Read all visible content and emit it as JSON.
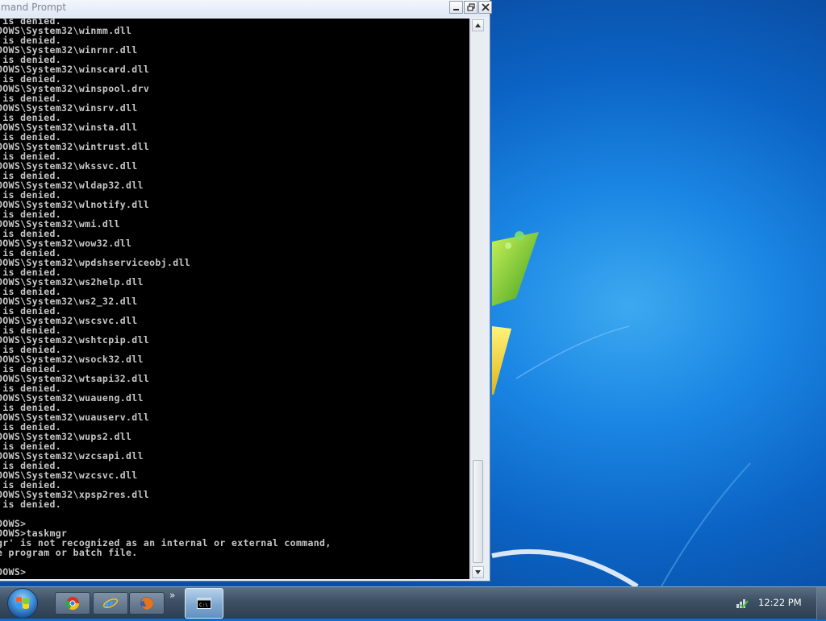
{
  "window": {
    "title": "mand Prompt",
    "min_glyph": "_",
    "restore_glyph": "❐",
    "close_glyph": "✕"
  },
  "console": {
    "lines": [
      " is denied.",
      "OOWS\\System32\\winmm.dll",
      " is denied.",
      "OOWS\\System32\\winrnr.dll",
      " is denied.",
      "OOWS\\System32\\winscard.dll",
      " is denied.",
      "OOWS\\System32\\winspool.drv",
      " is denied.",
      "OOWS\\System32\\winsrv.dll",
      " is denied.",
      "OOWS\\System32\\winsta.dll",
      " is denied.",
      "OOWS\\System32\\wintrust.dll",
      " is denied.",
      "OOWS\\System32\\wkssvc.dll",
      " is denied.",
      "OOWS\\System32\\wldap32.dll",
      " is denied.",
      "OOWS\\System32\\wlnotify.dll",
      " is denied.",
      "OOWS\\System32\\wmi.dll",
      " is denied.",
      "OOWS\\System32\\wow32.dll",
      " is denied.",
      "OOWS\\System32\\wpdshserviceobj.dll",
      " is denied.",
      "OOWS\\System32\\ws2help.dll",
      " is denied.",
      "OOWS\\System32\\ws2_32.dll",
      " is denied.",
      "OOWS\\System32\\wscsvc.dll",
      " is denied.",
      "OOWS\\System32\\wshtcpip.dll",
      " is denied.",
      "OOWS\\System32\\wsock32.dll",
      " is denied.",
      "OOWS\\System32\\wtsapi32.dll",
      " is denied.",
      "OOWS\\System32\\wuaueng.dll",
      " is denied.",
      "OOWS\\System32\\wuauserv.dll",
      " is denied.",
      "OOWS\\System32\\wups2.dll",
      " is denied.",
      "OOWS\\System32\\wzcsapi.dll",
      " is denied.",
      "OOWS\\System32\\wzcsvc.dll",
      " is denied.",
      "OOWS\\System32\\xpsp2res.dll",
      " is denied.",
      "",
      "OOWS>",
      "OOWS>taskmgr",
      "gr' is not recognized as an internal or external command,",
      "e program or batch file.",
      "",
      "OOWS>"
    ]
  },
  "taskbar": {
    "overflow_glyph": "»",
    "clock": "12:22 PM",
    "pinned": [
      "chrome-icon",
      "ie-icon",
      "firefox-icon"
    ],
    "active": "cmd-icon"
  },
  "colors": {
    "console_bg": "#000000",
    "console_text": "#c8c8c8",
    "desktop_blue": "#0b6fd0"
  }
}
